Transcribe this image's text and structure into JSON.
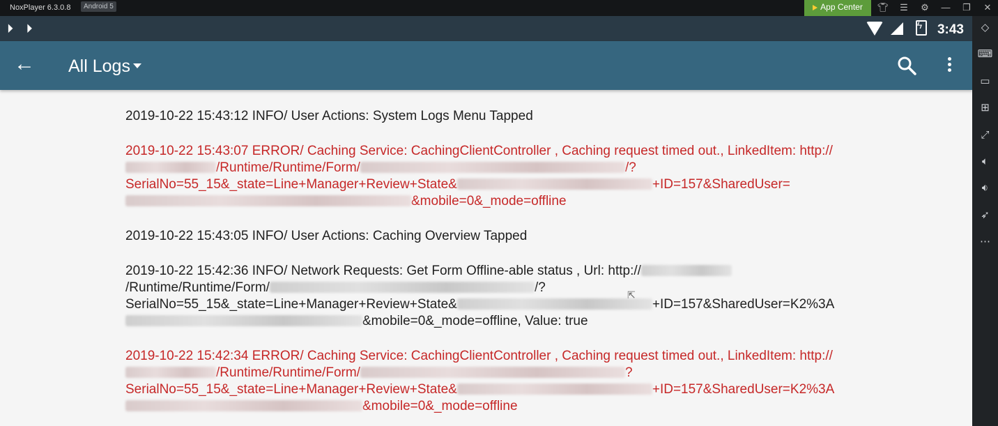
{
  "window": {
    "app_title": "NoxPlayer 6.3.0.8",
    "android_badge": "Android 5",
    "app_center_label": "App Center"
  },
  "statusbar": {
    "time": "3:43"
  },
  "toolbar": {
    "title": "All Logs"
  },
  "logs": [
    {
      "level": "info",
      "parts": [
        "2019-10-22 15:43:12  INFO/ User Actions: System Logs Menu Tapped"
      ]
    },
    {
      "level": "error",
      "parts": [
        "2019-10-22 15:43:07  ERROR/ Caching Service: CachingClientController , Caching request timed out., LinkedItem: http://",
        "/Runtime/Runtime/Form/",
        "/?SerialNo=55_15&_state=Line+Manager+Review+State&",
        "+ID=157&SharedUser=",
        "&mobile=0&_mode=offline"
      ]
    },
    {
      "level": "info",
      "parts": [
        "2019-10-22 15:43:05  INFO/ User Actions: Caching Overview Tapped"
      ]
    },
    {
      "level": "info",
      "parts": [
        "2019-10-22 15:42:36  INFO/ Network Requests: Get Form Offline-able status , Url: http://",
        "/Runtime/Runtime/Form/",
        "/?SerialNo=55_15&_state=Line+Manager+Review+State&",
        "+ID=157&SharedUser=K2%3A",
        "&mobile=0&_mode=offline, Value: true"
      ]
    },
    {
      "level": "error",
      "parts": [
        "2019-10-22 15:42:34  ERROR/ Caching Service: CachingClientController , Caching request timed out., LinkedItem: http://",
        "/Runtime/Runtime/Form/",
        "?SerialNo=55_15&_state=Line+Manager+Review+State&",
        "+ID=157&SharedUser=K2%3A",
        "&mobile=0&_mode=offline"
      ]
    }
  ]
}
